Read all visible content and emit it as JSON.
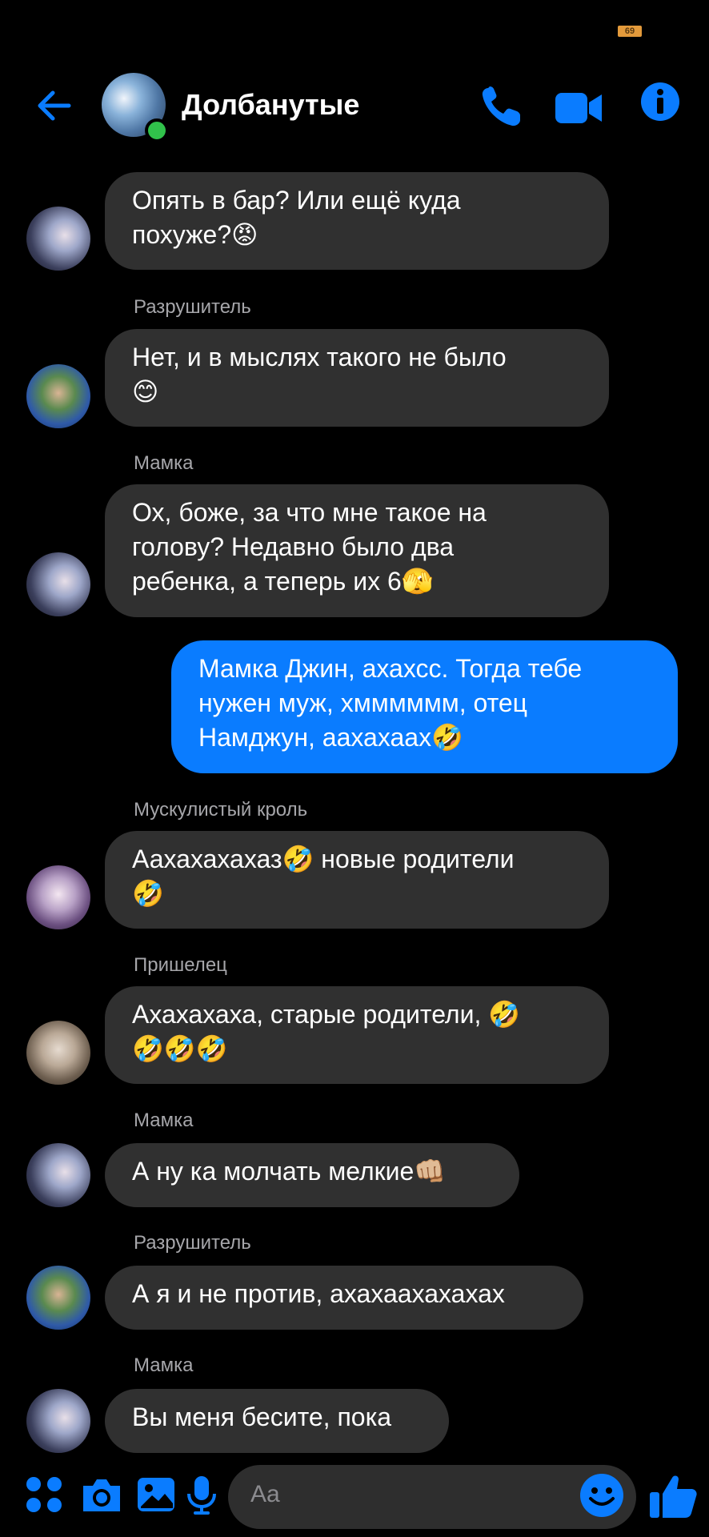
{
  "status_bar": {
    "battery": "69"
  },
  "header": {
    "title": "Долбанутые",
    "avatar_status": "online"
  },
  "messages": [
    {
      "sender": "",
      "avatar": "mamka",
      "text": "Опять в бар? Или ещё куда",
      "text2": "похуже?😡",
      "mine": false
    },
    {
      "sender": "Разрушитель",
      "avatar": "razrush",
      "text": "Нет, и в мыслях такого не было",
      "text2": "😊",
      "mine": false
    },
    {
      "sender": "Мамка",
      "avatar": "mamka",
      "text": "Ох, боже, за что мне такое на",
      "text2": "голову? Недавно было два",
      "text3": "ребенка, а теперь их 6🫣",
      "mine": false
    },
    {
      "sender": "",
      "avatar": "",
      "text": "Мамка Джин, ахахсс. Тогда тебе",
      "text2": "нужен муж, хмммммм, отец",
      "text3": "Намджун, аахахаах🤣",
      "mine": true
    },
    {
      "sender": "Мускулистый кроль",
      "avatar": "krol",
      "text": "Аахахахахаз🤣 новые родители",
      "text2": "🤣",
      "mine": false
    },
    {
      "sender": "Пришелец",
      "avatar": "prish",
      "text": "Ахахахаха, старые родители, 🤣",
      "text2": "🤣🤣🤣",
      "mine": false
    },
    {
      "sender": "Мамка",
      "avatar": "mamka",
      "text": "А ну ка молчать мелкие👊🏼",
      "mine": false
    },
    {
      "sender": "Разрушитель",
      "avatar": "razrush",
      "text": "А я и не против, ахахаахахахах",
      "mine": false
    },
    {
      "sender": "Мамка",
      "avatar": "mamka",
      "text": "Вы меня бесите, пока",
      "mine": false
    }
  ],
  "composer": {
    "placeholder": "Aa"
  },
  "colors": {
    "accent": "#0a7cff",
    "incoming_bubble": "#303030",
    "background": "#000000",
    "online": "#31c24b"
  },
  "icons": {
    "back": "arrow-left-icon",
    "call": "phone-icon",
    "video": "video-camera-icon",
    "info": "info-icon",
    "menu": "four-dots-icon",
    "camera": "camera-icon",
    "gallery": "image-icon",
    "mic": "microphone-icon",
    "emoji": "smiley-icon",
    "like": "thumbs-up-icon"
  }
}
